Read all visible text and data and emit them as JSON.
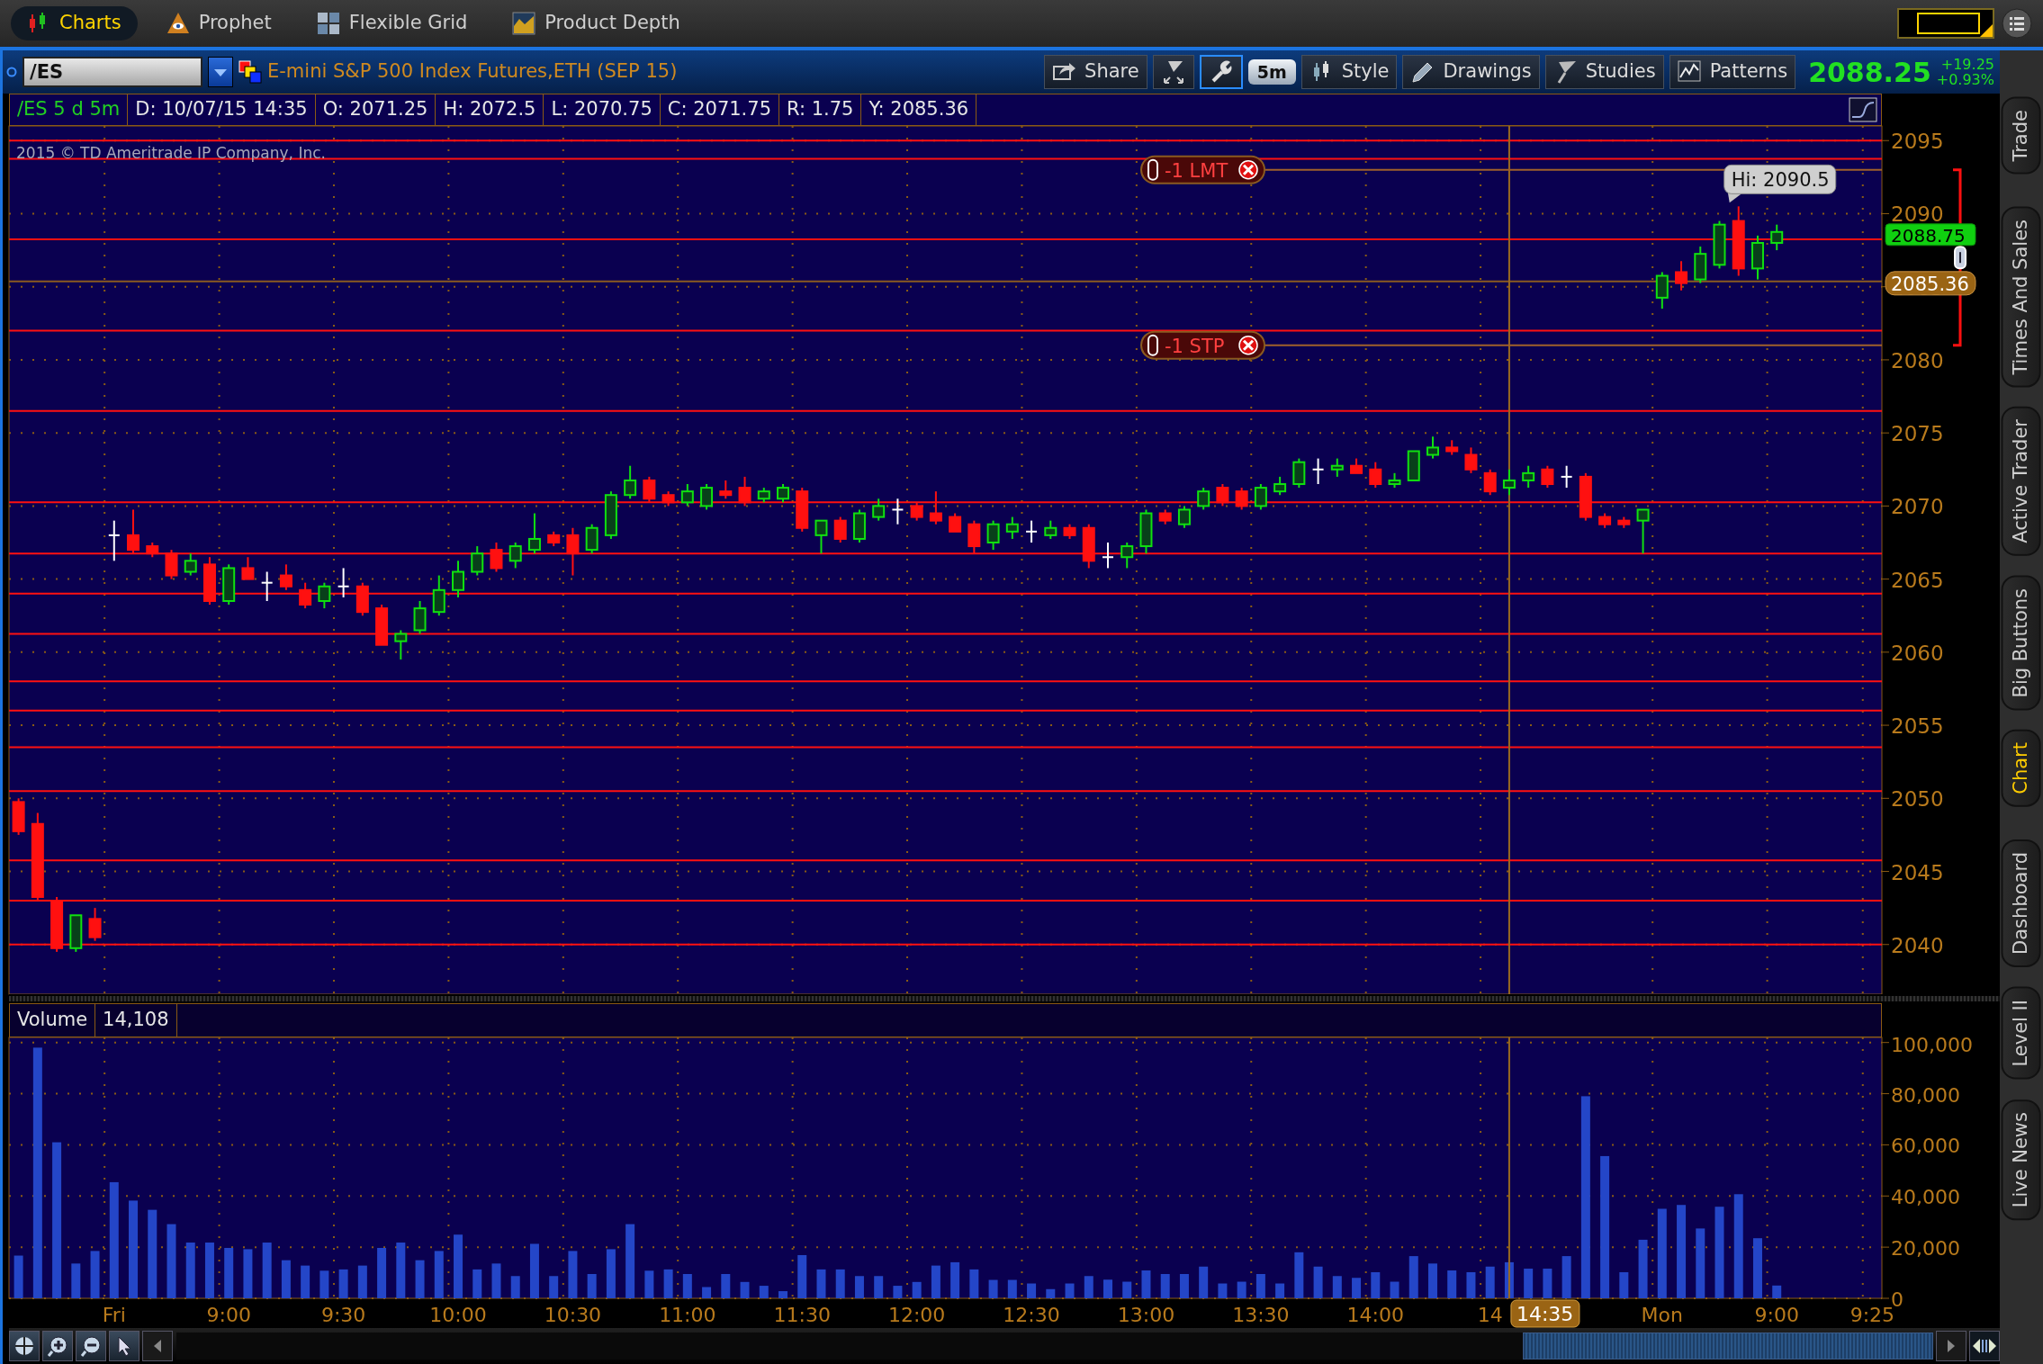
{
  "top_tabs": [
    {
      "label": "Charts",
      "selected": true
    },
    {
      "label": "Prophet",
      "selected": false
    },
    {
      "label": "Flexible Grid",
      "selected": false
    },
    {
      "label": "Product Depth",
      "selected": false
    }
  ],
  "header": {
    "symbol": "/ES",
    "description": "E-mini S&P 500 Index Futures,ETH (SEP 15)",
    "toolbar": [
      {
        "kind": "text",
        "label": "Share",
        "selected": false
      },
      {
        "kind": "icon",
        "selected": false
      },
      {
        "kind": "icon",
        "selected": true
      },
      {
        "kind": "pill",
        "label": "5m",
        "selected": false
      },
      {
        "kind": "text",
        "label": "Style",
        "selected": false
      },
      {
        "kind": "text",
        "label": "Drawings",
        "selected": false
      },
      {
        "kind": "text",
        "label": "Studies",
        "selected": false
      },
      {
        "kind": "text",
        "label": "Patterns",
        "selected": false
      }
    ],
    "last_price": "2088.25",
    "change": "+19.25",
    "change_percent": "+0.93%"
  },
  "info_bar": [
    {
      "kind": "symbol",
      "text": "/ES 5 d 5m"
    },
    {
      "kind": "value",
      "text": "D: 10/07/15 14:35"
    },
    {
      "kind": "value",
      "text": "O: 2071.25"
    },
    {
      "kind": "value",
      "text": "H: 2072.5"
    },
    {
      "kind": "value",
      "text": "L: 2070.75"
    },
    {
      "kind": "value",
      "text": "C: 2071.75"
    },
    {
      "kind": "value",
      "text": "R: 1.75"
    },
    {
      "kind": "value",
      "text": "Y: 2085.36"
    }
  ],
  "price_chart": {
    "copyright": "2015 © TD Ameritrade IP Company, Inc.",
    "chart_data": {
      "type": "candlestick",
      "grid": true,
      "categories": [
        null,
        null,
        null,
        null,
        null,
        null,
        null,
        null,
        null,
        null,
        null,
        null,
        null,
        null,
        null,
        null,
        null,
        null,
        null,
        null,
        null,
        null,
        null,
        null,
        null,
        null,
        null,
        null,
        null,
        null,
        null,
        null,
        null,
        null,
        null,
        null,
        null,
        null,
        null,
        null,
        null,
        null,
        null,
        null,
        null,
        null,
        null,
        null,
        null,
        null,
        null,
        null,
        null,
        null,
        null,
        null,
        null,
        null,
        null,
        null,
        null,
        null,
        null,
        null,
        null,
        null,
        null,
        null,
        null,
        null,
        null,
        null,
        null,
        null,
        null,
        null,
        null,
        null,
        null,
        null,
        null,
        null,
        null,
        null,
        null,
        null,
        null,
        null,
        null,
        null,
        null,
        null,
        null
      ],
      "ylim": [
        2036.6,
        2096.0
      ],
      "yticks": [
        2040,
        2045,
        2050,
        2055,
        2060,
        2065,
        2070,
        2075,
        2080,
        2085,
        2090,
        2095
      ],
      "ohlc": [
        [
          2049.75,
          2050,
          2047.5,
          2047.75
        ],
        [
          2048.25,
          2049,
          2043,
          2043.25
        ],
        [
          2043,
          2043.25,
          2039.5,
          2039.75
        ],
        [
          2039.75,
          2042,
          2039.5,
          2042
        ],
        [
          2041.75,
          2042.5,
          2040.25,
          2040.5
        ],
        [
          2068,
          2069,
          2066.25,
          2068
        ],
        [
          2068,
          2069.75,
          2066.75,
          2067
        ],
        [
          2067.25,
          2067.5,
          2066.5,
          2066.75
        ],
        [
          2066.75,
          2067,
          2065,
          2065.25
        ],
        [
          2065.5,
          2066.75,
          2065.25,
          2066.25
        ],
        [
          2066,
          2066.5,
          2063.25,
          2063.5
        ],
        [
          2063.5,
          2066,
          2063.25,
          2065.75
        ],
        [
          2065.75,
          2066.5,
          2065,
          2065
        ],
        [
          2064.75,
          2065.5,
          2063.5,
          2064.75
        ],
        [
          2065.25,
          2066,
          2064.25,
          2064.5
        ],
        [
          2064.25,
          2064.75,
          2063,
          2063.25
        ],
        [
          2063.5,
          2064.75,
          2063,
          2064.5
        ],
        [
          2064.5,
          2065.75,
          2063.75,
          2064.5
        ],
        [
          2064.5,
          2064.75,
          2062.5,
          2062.75
        ],
        [
          2063,
          2063.25,
          2060.5,
          2060.5
        ],
        [
          2060.75,
          2061.5,
          2059.5,
          2061.25
        ],
        [
          2061.5,
          2063.5,
          2061.25,
          2063
        ],
        [
          2062.75,
          2065.25,
          2062.5,
          2064.25
        ],
        [
          2064.25,
          2066.25,
          2063.75,
          2065.5
        ],
        [
          2065.5,
          2067.25,
          2065.25,
          2066.75
        ],
        [
          2067,
          2067.5,
          2065.5,
          2065.75
        ],
        [
          2066.25,
          2067.5,
          2065.75,
          2067.25
        ],
        [
          2067,
          2069.5,
          2066.75,
          2067.75
        ],
        [
          2068,
          2068.25,
          2067.25,
          2067.5
        ],
        [
          2068,
          2068.5,
          2065.25,
          2066.75
        ],
        [
          2067,
          2068.75,
          2066.75,
          2068.5
        ],
        [
          2068,
          2071,
          2067.75,
          2070.75
        ],
        [
          2070.75,
          2072.75,
          2070.5,
          2071.75
        ],
        [
          2071.75,
          2072,
          2070.25,
          2070.5
        ],
        [
          2070.75,
          2071,
          2070,
          2070.25
        ],
        [
          2070.25,
          2071.5,
          2070,
          2071
        ],
        [
          2070,
          2071.5,
          2069.75,
          2071.25
        ],
        [
          2071,
          2071.75,
          2070.5,
          2070.75
        ],
        [
          2071.25,
          2072,
          2070,
          2070.25
        ],
        [
          2070.5,
          2071.25,
          2070.25,
          2071
        ],
        [
          2070.5,
          2071.5,
          2070.25,
          2071.25
        ],
        [
          2071,
          2071.25,
          2068.25,
          2068.5
        ],
        [
          2068,
          2069,
          2066.75,
          2069
        ],
        [
          2069,
          2069.25,
          2067.5,
          2067.75
        ],
        [
          2067.75,
          2069.75,
          2067.5,
          2069.5
        ],
        [
          2069.25,
          2070.5,
          2069,
          2070
        ],
        [
          2069.75,
          2070.5,
          2068.75,
          2069.75
        ],
        [
          2070,
          2070.25,
          2069,
          2069.25
        ],
        [
          2069.5,
          2071,
          2068.75,
          2069
        ],
        [
          2069.25,
          2069.5,
          2068.25,
          2068.25
        ],
        [
          2068.75,
          2069,
          2066.75,
          2067.25
        ],
        [
          2067.5,
          2069,
          2067,
          2068.75
        ],
        [
          2068.25,
          2069.25,
          2067.75,
          2068.75
        ],
        [
          2068.25,
          2069,
          2067.5,
          2068.25
        ],
        [
          2068,
          2069,
          2067.75,
          2068.5
        ],
        [
          2068.5,
          2068.75,
          2067.75,
          2068
        ],
        [
          2068.5,
          2068.75,
          2065.75,
          2066.25
        ],
        [
          2066.5,
          2067.5,
          2065.75,
          2066.5
        ],
        [
          2066.5,
          2067.5,
          2065.75,
          2067.25
        ],
        [
          2067.25,
          2069.75,
          2066.75,
          2069.5
        ],
        [
          2069.5,
          2069.75,
          2068.75,
          2069
        ],
        [
          2068.75,
          2070,
          2068.5,
          2069.75
        ],
        [
          2070,
          2071.25,
          2069.75,
          2071
        ],
        [
          2071.25,
          2071.5,
          2070,
          2070.25
        ],
        [
          2071,
          2071.25,
          2069.75,
          2070
        ],
        [
          2070,
          2071.5,
          2069.75,
          2071.25
        ],
        [
          2071,
          2072,
          2070.75,
          2071.5
        ],
        [
          2071.5,
          2073.25,
          2071.25,
          2073
        ],
        [
          2072.5,
          2073.25,
          2071.5,
          2072.5
        ],
        [
          2072.5,
          2073.25,
          2072,
          2072.75
        ],
        [
          2072.75,
          2073.25,
          2072.25,
          2072.25
        ],
        [
          2072.5,
          2073,
          2071.25,
          2071.5
        ],
        [
          2071.5,
          2072.25,
          2071.25,
          2071.75
        ],
        [
          2071.75,
          2073.75,
          2071.75,
          2073.75
        ],
        [
          2073.5,
          2074.75,
          2073.25,
          2074
        ],
        [
          2074,
          2074.5,
          2073.5,
          2073.75
        ],
        [
          2073.5,
          2074,
          2072.25,
          2072.5
        ],
        [
          2072.25,
          2072.5,
          2070.75,
          2071
        ],
        [
          2071.25,
          2072.5,
          2070.75,
          2071.75
        ],
        [
          2071.75,
          2072.75,
          2071.25,
          2072.25
        ],
        [
          2072.5,
          2072.75,
          2071.25,
          2071.5
        ],
        [
          2072,
          2072.75,
          2071.25,
          2072
        ],
        [
          2072,
          2072.25,
          2069,
          2069.25
        ],
        [
          2069.25,
          2069.5,
          2068.5,
          2068.75
        ],
        [
          2069,
          2069.25,
          2068.5,
          2068.75
        ],
        [
          2069,
          2069.75,
          2066.75,
          2069.75
        ],
        [
          2084.25,
          2086,
          2083.5,
          2085.75
        ],
        [
          2086,
          2086.75,
          2084.75,
          2085.25
        ],
        [
          2085.5,
          2087.75,
          2085.25,
          2087.25
        ],
        [
          2086.5,
          2089.5,
          2086.25,
          2089.25
        ],
        [
          2089.5,
          2090.5,
          2085.75,
          2086.25
        ],
        [
          2086.25,
          2088.5,
          2085.5,
          2088
        ],
        [
          2088,
          2089.25,
          2087.5,
          2088.75
        ]
      ],
      "ref_lines": [
        {
          "axis": "y",
          "value": 2095,
          "color": "#ff1010"
        },
        {
          "axis": "y",
          "value": 2093.75,
          "color": "#ff1010"
        },
        {
          "axis": "y",
          "value": 2088.25,
          "color": "#ff1010"
        },
        {
          "axis": "y",
          "value": 2082,
          "color": "#ff1010"
        },
        {
          "axis": "y",
          "value": 2076.5,
          "color": "#ff1010"
        },
        {
          "axis": "y",
          "value": 2070.25,
          "color": "#ff1010"
        },
        {
          "axis": "y",
          "value": 2066.75,
          "color": "#ff1010"
        },
        {
          "axis": "y",
          "value": 2064,
          "color": "#ff1010"
        },
        {
          "axis": "y",
          "value": 2061.25,
          "color": "#ff1010"
        },
        {
          "axis": "y",
          "value": 2058,
          "color": "#ff1010"
        },
        {
          "axis": "y",
          "value": 2056,
          "color": "#ff1010"
        },
        {
          "axis": "y",
          "value": 2053.5,
          "color": "#ff1010"
        },
        {
          "axis": "y",
          "value": 2050.5,
          "color": "#ff1010"
        },
        {
          "axis": "y",
          "value": 2045.75,
          "color": "#ff1010"
        },
        {
          "axis": "y",
          "value": 2043,
          "color": "#ff1010"
        },
        {
          "axis": "y",
          "value": 2040,
          "color": "#ff1010"
        },
        {
          "axis": "y",
          "value": 2093,
          "label": "-1 LMT",
          "color": "#a0602a"
        },
        {
          "axis": "y",
          "value": 2081,
          "label": "-1 STP",
          "color": "#a0602a"
        },
        {
          "axis": "y",
          "value": 2085.36,
          "label": "2085.36",
          "color": "#8a5a20"
        }
      ],
      "annotations": [
        "Hi: 2090.5",
        "2088.75"
      ]
    }
  },
  "volume_chart": {
    "reading": "14,108",
    "chart_data": {
      "type": "bar",
      "title": "Volume",
      "grid": true,
      "categories": [
        null,
        null,
        null,
        null,
        null,
        "Fri",
        null,
        null,
        null,
        null,
        null,
        "9:00",
        null,
        null,
        null,
        null,
        null,
        "9:30",
        null,
        null,
        null,
        null,
        null,
        "10:00",
        null,
        null,
        null,
        null,
        null,
        "10:30",
        null,
        null,
        null,
        null,
        null,
        "11:00",
        null,
        null,
        null,
        null,
        null,
        "11:30",
        null,
        null,
        null,
        null,
        null,
        "12:00",
        null,
        null,
        null,
        null,
        null,
        "12:30",
        null,
        null,
        null,
        null,
        null,
        "13:00",
        null,
        null,
        null,
        null,
        null,
        "13:30",
        null,
        null,
        null,
        null,
        null,
        "14:00",
        null,
        null,
        null,
        null,
        null,
        "14",
        null,
        null,
        null,
        null,
        null,
        null,
        null,
        null,
        "Mon",
        null,
        null,
        null,
        null,
        null,
        "9:00",
        null,
        null,
        null,
        null,
        "9:25"
      ],
      "ylim": [
        0,
        102000
      ],
      "yticks": [
        {
          "value": 0,
          "label": "0"
        },
        {
          "value": 20000,
          "label": "20,000"
        },
        {
          "value": 40000,
          "label": "40,000"
        },
        {
          "value": 60000,
          "label": "60,000"
        },
        {
          "value": 80000,
          "label": "80,000"
        },
        {
          "value": 100000,
          "label": "100,000"
        }
      ],
      "values": [
        16700,
        98000,
        61000,
        13600,
        18500,
        45400,
        38200,
        34600,
        29000,
        21800,
        21800,
        19700,
        19200,
        21800,
        14900,
        12800,
        10800,
        11300,
        12800,
        19700,
        21800,
        14900,
        18500,
        24900,
        11300,
        13600,
        8700,
        21300,
        8700,
        18500,
        9500,
        19200,
        29000,
        10800,
        11300,
        9500,
        4400,
        9500,
        6400,
        4900,
        2800,
        16900,
        11300,
        11300,
        8700,
        8700,
        4900,
        6400,
        12800,
        14100,
        11300,
        7200,
        7200,
        5800,
        3600,
        5800,
        8700,
        7300,
        6500,
        10900,
        9500,
        9500,
        12400,
        5800,
        6500,
        9500,
        5800,
        18000,
        12400,
        8700,
        8000,
        10200,
        6500,
        16500,
        13600,
        10900,
        10200,
        12400,
        14100,
        11600,
        11600,
        16500,
        79000,
        55600,
        10200,
        22900,
        35000,
        36500,
        27300,
        35800,
        40700,
        23500,
        5000,
        null,
        null,
        null,
        null,
        null
      ],
      "annotations": [
        "14:35"
      ]
    }
  },
  "side_tabs": [
    {
      "label": "Trade",
      "selected": false
    },
    {
      "label": "Times And Sales",
      "selected": false
    },
    {
      "label": "Active Trader",
      "selected": false
    },
    {
      "label": "Big Buttons",
      "selected": false
    },
    {
      "label": "Chart",
      "selected": true
    },
    {
      "label": "Dashboard",
      "selected": false
    },
    {
      "label": "Level II",
      "selected": false
    },
    {
      "label": "Live News",
      "selected": false
    }
  ]
}
